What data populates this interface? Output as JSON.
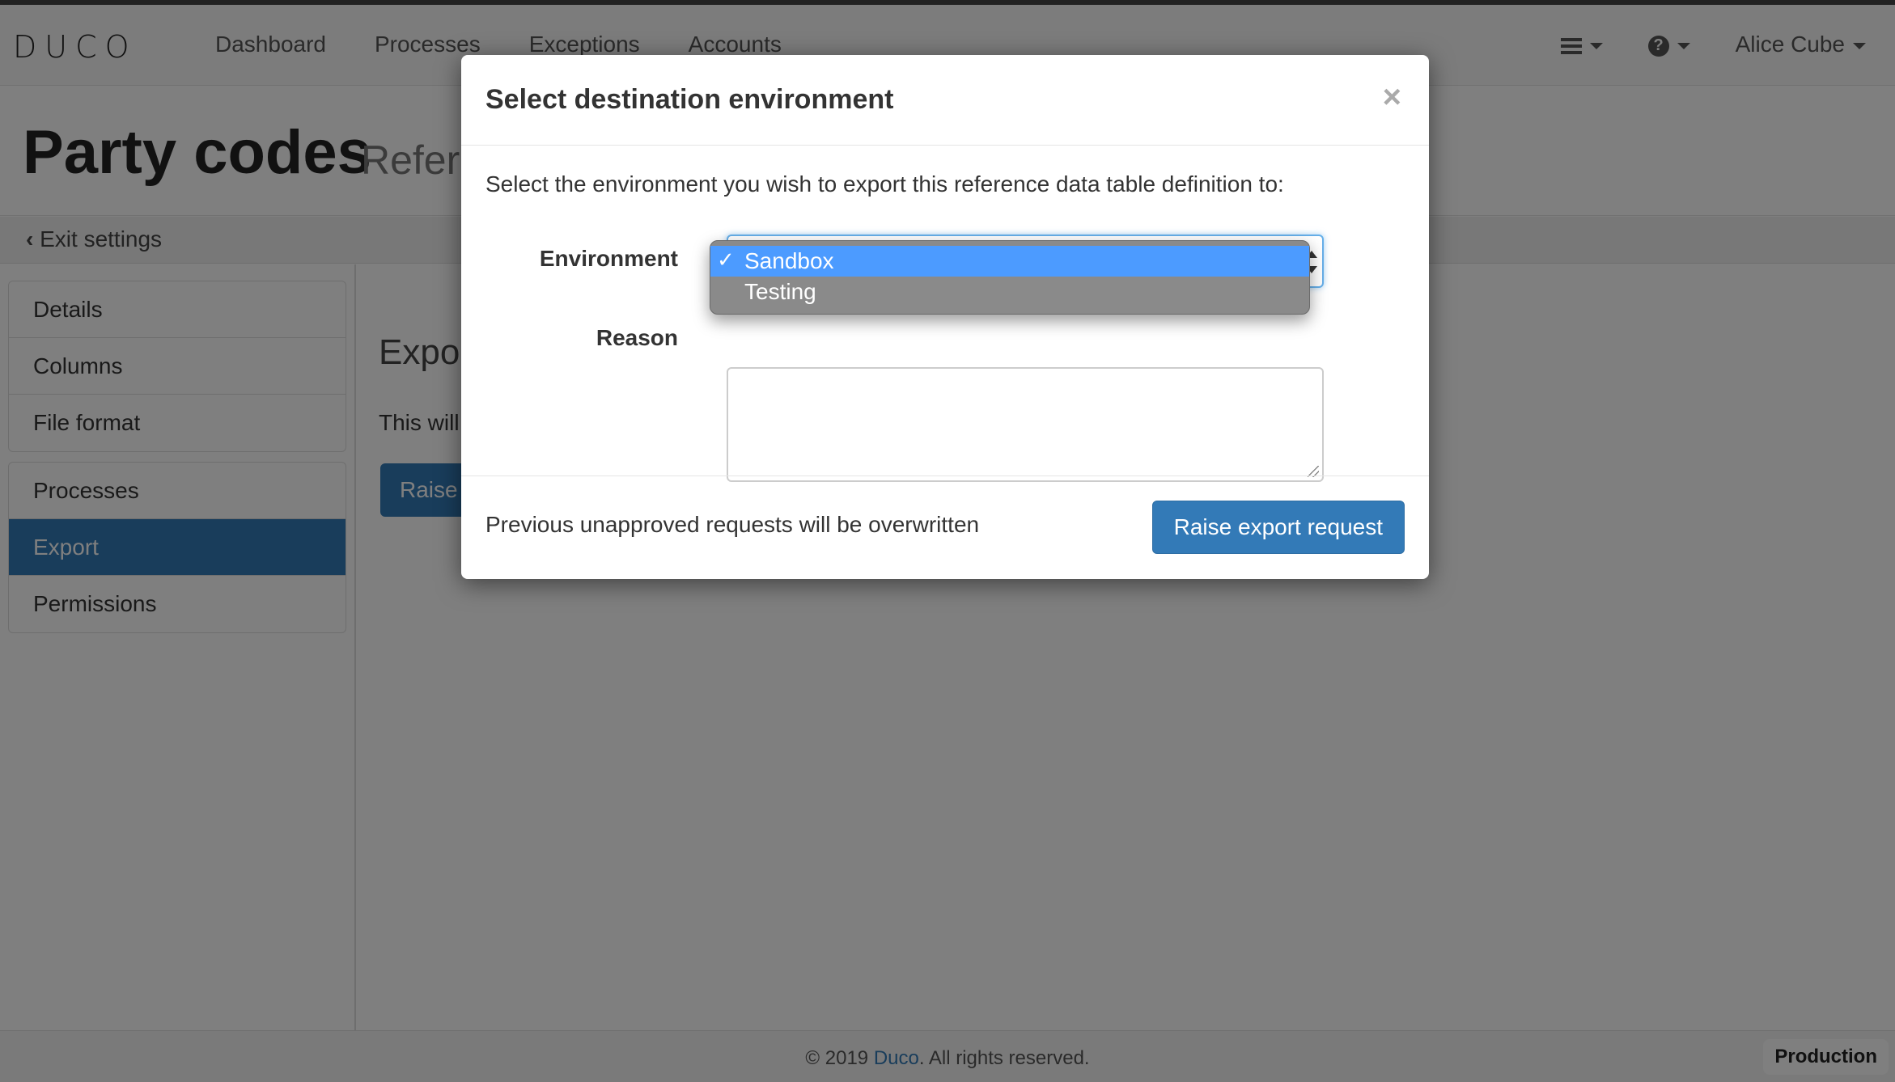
{
  "app": {
    "logo": "DUCO"
  },
  "nav": {
    "links": [
      "Dashboard",
      "Processes",
      "Exceptions",
      "Accounts"
    ],
    "user": "Alice Cube"
  },
  "page": {
    "title": "Party codes",
    "subtitle": "Refere",
    "exit_label": "Exit settings"
  },
  "sidebar": {
    "group1": [
      "Details",
      "Columns",
      "File format"
    ],
    "group2": [
      "Processes",
      "Export",
      "Permissions"
    ],
    "active": "Export"
  },
  "content": {
    "heading": "Expor",
    "text": "This will",
    "button": "Raise"
  },
  "modal": {
    "title": "Select destination environment",
    "close": "×",
    "instruction": "Select the environment you wish to export this reference data table definition to:",
    "environment_label": "Environment",
    "reason_label": "Reason",
    "reason_value": "",
    "environment_options": [
      "Sandbox",
      "Testing"
    ],
    "selected_option": "Sandbox",
    "footer_note": "Previous unapproved requests will be overwritten",
    "submit_label": "Raise export request"
  },
  "footer": {
    "copyright_prefix": "© 2019 ",
    "company": "Duco",
    "copyright_suffix": ". All rights reserved.",
    "environment_badge": "Production"
  },
  "colors": {
    "primary": "#337ab7",
    "dropdown_highlight": "#4c9bff",
    "backdrop": "rgba(0,0,0,0.5)"
  }
}
